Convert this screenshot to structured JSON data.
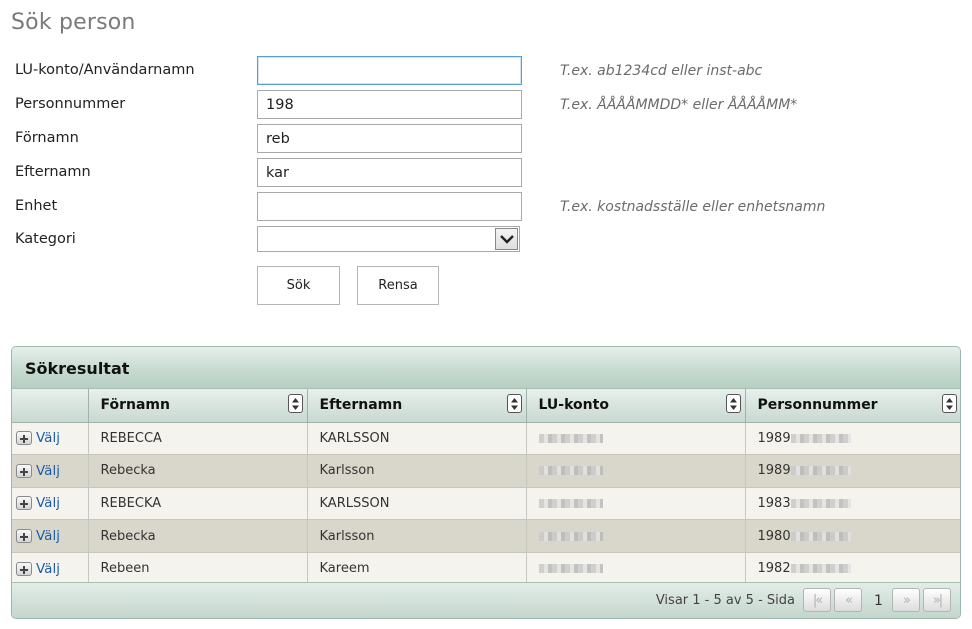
{
  "page_title": "Sök person",
  "form": {
    "lu_konto": {
      "label": "LU-konto/Användarnamn",
      "value": "",
      "hint": "T.ex. ab1234cd eller inst-abc"
    },
    "personnummer": {
      "label": "Personnummer",
      "value": "198",
      "hint": "T.ex. ÅÅÅÅMMDD* eller ÅÅÅÅMM*"
    },
    "fornamn": {
      "label": "Förnamn",
      "value": "reb"
    },
    "efternamn": {
      "label": "Efternamn",
      "value": "kar"
    },
    "enhet": {
      "label": "Enhet",
      "value": "",
      "hint": "T.ex. kostnadsställe eller enhetsnamn"
    },
    "kategori": {
      "label": "Kategori",
      "value": ""
    },
    "search_button": "Sök",
    "clear_button": "Rensa"
  },
  "results": {
    "title": "Sökresultat",
    "columns": [
      "",
      "Förnamn",
      "Efternamn",
      "LU-konto",
      "Personnummer"
    ],
    "select_label": "Välj",
    "rows": [
      {
        "fornamn": "REBECCA",
        "efternamn": "KARLSSON",
        "pnr_prefix": "1989"
      },
      {
        "fornamn": "Rebecka",
        "efternamn": "Karlsson",
        "pnr_prefix": "1989"
      },
      {
        "fornamn": "REBECKA",
        "efternamn": "KARLSSON",
        "pnr_prefix": "1983"
      },
      {
        "fornamn": "Rebecka",
        "efternamn": "Karlsson",
        "pnr_prefix": "1980"
      },
      {
        "fornamn": "Rebeen",
        "efternamn": "Kareem",
        "pnr_prefix": "1982"
      }
    ],
    "pager": {
      "info": "Visar 1 - 5 av 5 - Sida",
      "current_page": "1",
      "first_icon": "first-page-icon",
      "prev_icon": "prev-page-icon",
      "next_icon": "next-page-icon",
      "last_icon": "last-page-icon"
    }
  },
  "colors": {
    "accent_link": "#1f5fa8",
    "panel_header": "#c5d9cf",
    "row_alt": "#d9d6cb"
  }
}
